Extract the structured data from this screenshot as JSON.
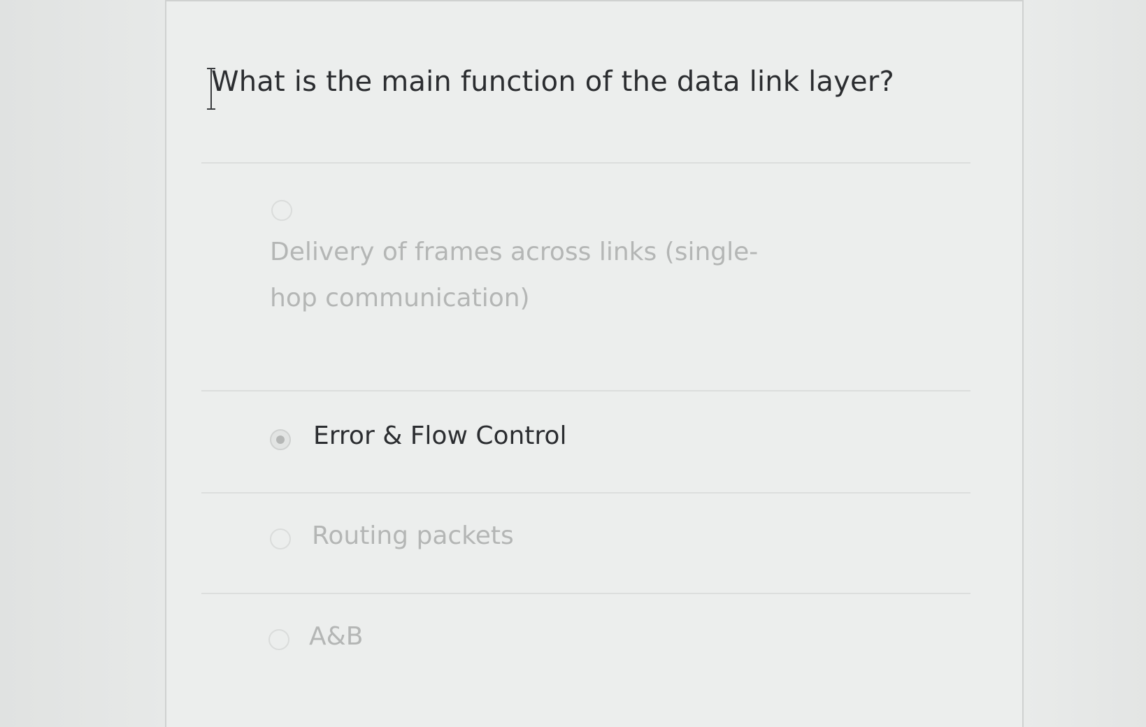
{
  "question": {
    "text": "What is the main function of the data link layer?"
  },
  "options": [
    {
      "label": "Delivery of frames across links (single-hop communication)",
      "selected": false
    },
    {
      "label": "Error & Flow Control",
      "selected": true
    },
    {
      "label": "Routing packets",
      "selected": false
    },
    {
      "label": "A&B",
      "selected": false
    }
  ],
  "icons": {
    "cursor": "text-cursor-icon"
  },
  "colors": {
    "question_text": "#2b2d30",
    "selected_option_text": "#2b2d30",
    "unselected_option_text": "#b4b6b5",
    "card_background": "#eceeed"
  }
}
